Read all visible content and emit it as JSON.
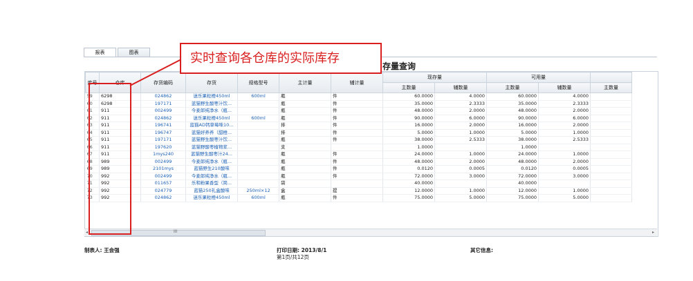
{
  "tabs": [
    "报表",
    "图表"
  ],
  "report_title": "存量查询",
  "header_groups": {
    "current": "现存量",
    "available": "可用量"
  },
  "columns": [
    "库号",
    "仓库",
    "存货编码",
    "存货",
    "规格型号",
    "主计量",
    "辅计量",
    "主数量",
    "辅数量",
    "主数量",
    "辅数量",
    "主数量"
  ],
  "rows": [
    [
      "59",
      "6298",
      "024862",
      "迷乐果粒橙450ml",
      "600ml",
      "瓶",
      "件",
      "60.0000",
      "4.0000",
      "60.0000",
      "4.0000"
    ],
    [
      "60",
      "6298",
      "197171",
      "蓝猫野生酸枣汁饮...",
      "",
      "瓶",
      "件",
      "35.0000",
      "2.3333",
      "35.0000",
      "2.3333"
    ],
    [
      "61",
      "911",
      "002499",
      "今麦郎纯净水（瓶...",
      "",
      "瓶",
      "件",
      "48.0000",
      "2.0000",
      "48.0000",
      "2.0000"
    ],
    [
      "62",
      "911",
      "024862",
      "迷乐果粒橙450ml",
      "600ml",
      "瓶",
      "件",
      "90.0000",
      "6.0000",
      "90.0000",
      "6.0000"
    ],
    [
      "63",
      "911",
      "196741",
      "蓝猫AD钙草莓味10...",
      "",
      "排",
      "件",
      "16.0000",
      "2.0000",
      "16.0000",
      "2.0000"
    ],
    [
      "64",
      "911",
      "196747",
      "蓝猫好养养（甜橙...",
      "",
      "排",
      "件",
      "5.0000",
      "1.0000",
      "5.0000",
      "1.0000"
    ],
    [
      "65",
      "911",
      "197171",
      "蓝猫野生酸枣汁饮...",
      "",
      "瓶",
      "件",
      "38.0000",
      "2.5333",
      "38.0000",
      "2.5333"
    ],
    [
      "66",
      "911",
      "197620",
      "蓝猫野酸枣植物浆...",
      "",
      "支",
      "",
      "1.0000",
      "",
      "1.0000",
      ""
    ],
    [
      "67",
      "911",
      "1mys240",
      "蓝猫野生酸枣汁24...",
      "",
      "瓶",
      "件",
      "24.0000",
      "1.0000",
      "24.0000",
      "1.0000"
    ],
    [
      "68",
      "989",
      "002499",
      "今麦郎纯净水（瓶...",
      "",
      "瓶",
      "件",
      "48.0000",
      "2.0000",
      "48.0000",
      "2.0000"
    ],
    [
      "69",
      "989",
      "2101mys",
      "蓝猫野生210酸味",
      "",
      "瓶",
      "件",
      "0.0120",
      "0.0005",
      "0.0120",
      "0.0005"
    ],
    [
      "70",
      "992",
      "002499",
      "今麦郎纯净水（瓶...",
      "",
      "瓶",
      "件",
      "72.0000",
      "3.0000",
      "72.0000",
      "3.0000"
    ],
    [
      "71",
      "992",
      "011657",
      "乐和粉果香型（简...",
      "",
      "袋",
      "",
      "40.0000",
      "",
      "40.0000",
      ""
    ],
    [
      "72",
      "992",
      "024779",
      "蓝猫250礼盒酸味",
      "250ml×12",
      "盒",
      "提",
      "12.0000",
      "1.0000",
      "12.0000",
      "1.0000"
    ],
    [
      "73",
      "992",
      "024862",
      "迷乐果粒橙450ml",
      "600ml",
      "瓶",
      "件",
      "75.0000",
      "5.0000",
      "75.0000",
      "5.0000"
    ]
  ],
  "scroll_thumb_label": "III",
  "footer": {
    "maker": "制表人: 王会强",
    "print_date": "打印日期: 2013/8/1",
    "page": "第1页/共12页",
    "other": "其它信息:"
  },
  "annotation": {
    "callout_text": "实时查询各仓库的实际库存",
    "color": "#d81e1e"
  }
}
